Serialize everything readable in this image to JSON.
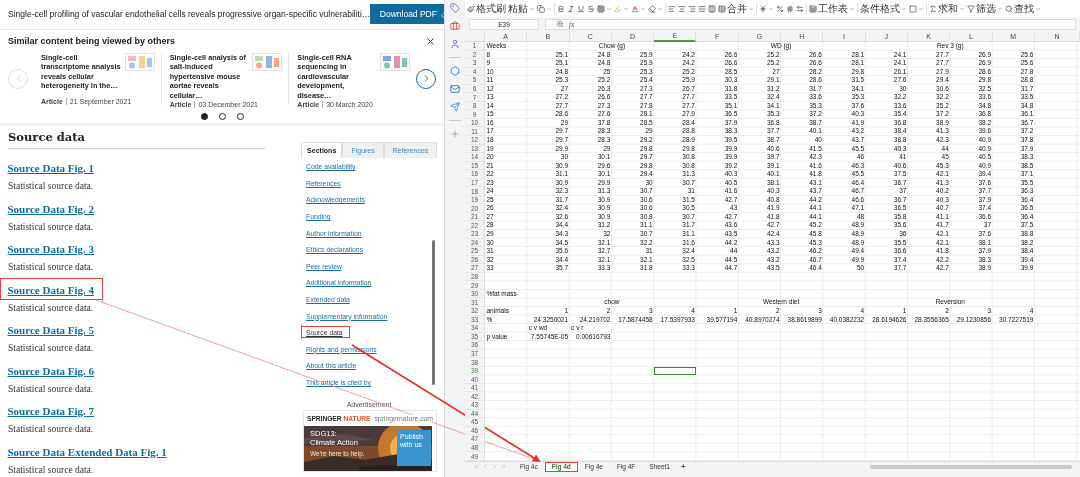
{
  "article": {
    "title": "Single-cell profiling of vascular endothelial cells reveals progressive organ-specific vulnerabiliti…",
    "download_button": "Download PDF"
  },
  "similar": {
    "heading": "Similar content being viewed by others",
    "cards": [
      {
        "title": "Single-cell transcriptome analysis reveals cellular heterogeneity in the…",
        "type": "Article",
        "date": "21 September 2021"
      },
      {
        "title": "Single-cell analysis of salt-induced hypertensive mouse aortae reveals cellular…",
        "type": "Article",
        "date": "03 December 2021"
      },
      {
        "title": "Single-cell RNA sequencing in cardiovascular development, disease…",
        "type": "Article",
        "date": "30 March 2020"
      }
    ],
    "dots": [
      {
        "selected": true
      },
      {
        "selected": false
      },
      {
        "selected": false
      }
    ]
  },
  "source_data": {
    "heading": "Source data",
    "items": [
      {
        "title": "Source Data Fig. 1",
        "description": "Statistical source data.",
        "highlighted": false
      },
      {
        "title": "Source Data Fig. 2",
        "description": "Statistical source data.",
        "highlighted": false
      },
      {
        "title": "Source Data Fig. 3",
        "description": "Statistical source data.",
        "highlighted": false
      },
      {
        "title": "Source Data Fig. 4",
        "description": "Statistical source data.",
        "highlighted": true
      },
      {
        "title": "Source Data Fig. 5",
        "description": "Statistical source data.",
        "highlighted": false
      },
      {
        "title": "Source Data Fig. 6",
        "description": "Statistical source data.",
        "highlighted": false
      },
      {
        "title": "Source Data Fig. 7",
        "description": "Statistical source data.",
        "highlighted": false
      },
      {
        "title": "Source Data Extended Data Fig. 1",
        "description": "Statistical source data.",
        "highlighted": false
      }
    ]
  },
  "sidebar": {
    "tabs": [
      {
        "label": "Sections",
        "selected": true
      },
      {
        "label": "Figures",
        "selected": false
      },
      {
        "label": "References",
        "selected": false
      }
    ],
    "items": [
      {
        "label": "Code availability",
        "selected": false,
        "highlighted": false
      },
      {
        "label": "References",
        "selected": false,
        "highlighted": false
      },
      {
        "label": "Acknowledgements",
        "selected": false,
        "highlighted": false
      },
      {
        "label": "Funding",
        "selected": false,
        "highlighted": false
      },
      {
        "label": "Author information",
        "selected": false,
        "highlighted": false
      },
      {
        "label": "Ethics declarations",
        "selected": false,
        "highlighted": false
      },
      {
        "label": "Peer review",
        "selected": false,
        "highlighted": false
      },
      {
        "label": "Additional information",
        "selected": false,
        "highlighted": false
      },
      {
        "label": "Extended data",
        "selected": false,
        "highlighted": false
      },
      {
        "label": "Supplementary information",
        "selected": false,
        "highlighted": false
      },
      {
        "label": "Source data",
        "selected": true,
        "highlighted": true
      },
      {
        "label": "Rights and permissions",
        "selected": false,
        "highlighted": false
      },
      {
        "label": "About this article",
        "selected": false,
        "highlighted": false
      },
      {
        "label": "This article is cited by",
        "selected": false,
        "highlighted": false
      }
    ]
  },
  "advertisement": {
    "label": "Advertisement",
    "brand_words": [
      "SPRINGER",
      "NATURE"
    ],
    "site": "springernature.com",
    "headline": [
      "SDG13:",
      "Climate Action"
    ],
    "tagline": "We're here to help.",
    "badge": "Publish with us"
  },
  "spreadsheet": {
    "toolbar_labels": [
      "格式刷",
      "粘贴",
      "合并",
      "工作表",
      "条件格式",
      "求和",
      "筛选",
      "查找"
    ],
    "name_box": "E39",
    "function_label": "fx",
    "columns": [
      {
        "label": "A",
        "selected": false
      },
      {
        "label": "B",
        "selected": false
      },
      {
        "label": "C",
        "selected": false
      },
      {
        "label": "D",
        "selected": false
      },
      {
        "label": "E",
        "selected": true
      },
      {
        "label": "F",
        "selected": false
      },
      {
        "label": "G",
        "selected": false
      },
      {
        "label": "H",
        "selected": false
      },
      {
        "label": "I",
        "selected": false
      },
      {
        "label": "J",
        "selected": false
      },
      {
        "label": "K",
        "selected": false
      },
      {
        "label": "L",
        "selected": false
      },
      {
        "label": "M",
        "selected": false
      },
      {
        "label": "N",
        "selected": false
      }
    ],
    "rows": [
      {
        "num": "1",
        "selected": false,
        "kind": "header",
        "cells": [
          "Weeks",
          "Chow (g)",
          "WD (g)",
          "Rev 3 (g)"
        ]
      },
      {
        "num": "2",
        "selected": false,
        "kind": "data",
        "cells": [
          "8",
          "25.1",
          "24.8",
          "25.9",
          "24.2",
          "26.6",
          "25.2",
          "26.6",
          "28.1",
          "24.1",
          "27.7",
          "26.9",
          "25.6"
        ]
      },
      {
        "num": "3",
        "selected": false,
        "kind": "data",
        "cells": [
          "9",
          "25.1",
          "24.8",
          "25.9",
          "24.2",
          "26.6",
          "25.2",
          "26.6",
          "28.1",
          "24.1",
          "27.7",
          "26.9",
          "25.6"
        ]
      },
      {
        "num": "4",
        "selected": false,
        "kind": "data",
        "cells": [
          "10",
          "24.8",
          "25",
          "25.3",
          "25.2",
          "28.5",
          "27",
          "28.2",
          "29.8",
          "26.1",
          "27.9",
          "28.6",
          "27.8"
        ]
      },
      {
        "num": "5",
        "selected": false,
        "kind": "data",
        "cells": [
          "11",
          "25.3",
          "25.2",
          "25.4",
          "25.9",
          "30.3",
          "29.1",
          "28.6",
          "31.5",
          "27.6",
          "29.4",
          "29.8",
          "28.8"
        ]
      },
      {
        "num": "6",
        "selected": false,
        "kind": "data",
        "cells": [
          "12",
          "27",
          "26.3",
          "27.3",
          "26.7",
          "31.8",
          "31.2",
          "31.7",
          "34.1",
          "30",
          "30.6",
          "32.5",
          "31.7"
        ]
      },
      {
        "num": "7",
        "selected": false,
        "kind": "data",
        "cells": [
          "13",
          "27.2",
          "26.6",
          "27.7",
          "27.7",
          "33.5",
          "32.4",
          "33.6",
          "35.3",
          "32.2",
          "32.2",
          "33.6",
          "33.5"
        ]
      },
      {
        "num": "8",
        "selected": false,
        "kind": "data",
        "cells": [
          "14",
          "27.7",
          "27.3",
          "27.8",
          "27.7",
          "35.1",
          "34.1",
          "35.3",
          "37.6",
          "33.6",
          "35.2",
          "34.8",
          "34.8"
        ]
      },
      {
        "num": "9",
        "selected": false,
        "kind": "data",
        "cells": [
          "15",
          "28.6",
          "27.6",
          "28.1",
          "27.9",
          "36.5",
          "35.3",
          "37.2",
          "40.3",
          "35.4",
          "37.2",
          "36.8",
          "36.1"
        ]
      },
      {
        "num": "10",
        "selected": false,
        "kind": "data",
        "cells": [
          "16",
          "29",
          "37.8",
          "28.5",
          "28.4",
          "37.9",
          "36.8",
          "38.7",
          "41.9",
          "36.8",
          "38.9",
          "38.2",
          "36.7"
        ]
      },
      {
        "num": "11",
        "selected": false,
        "kind": "data",
        "cells": [
          "17",
          "29.7",
          "28.3",
          "29",
          "28.8",
          "38.3",
          "37.7",
          "40.1",
          "43.2",
          "38.4",
          "41.3",
          "39.6",
          "37.2"
        ]
      },
      {
        "num": "12",
        "selected": false,
        "kind": "data",
        "cells": [
          "18",
          "29.7",
          "28.3",
          "29.2",
          "28.9",
          "39.5",
          "38.7",
          "40",
          "43.7",
          "38.8",
          "42.3",
          "40.9",
          "37.8"
        ]
      },
      {
        "num": "13",
        "selected": false,
        "kind": "data",
        "cells": [
          "19",
          "29.9",
          "29",
          "29.8",
          "29.8",
          "39.9",
          "40.6",
          "41.5",
          "45.5",
          "40.3",
          "44",
          "40.9",
          "37.9"
        ]
      },
      {
        "num": "14",
        "selected": false,
        "kind": "data",
        "cells": [
          "20",
          "30",
          "30.1",
          "29.7",
          "30.8",
          "39.9",
          "39.7",
          "42.3",
          "46",
          "41",
          "45",
          "40.5",
          "38.3"
        ]
      },
      {
        "num": "15",
        "selected": false,
        "kind": "data",
        "cells": [
          "21",
          "30.9",
          "29.6",
          "29.8",
          "30.8",
          "39.2",
          "39.1",
          "41.6",
          "46.3",
          "40.6",
          "45.3",
          "40.9",
          "38.5"
        ]
      },
      {
        "num": "16",
        "selected": false,
        "kind": "data",
        "cells": [
          "22",
          "31.1",
          "30.1",
          "29.4",
          "31.3",
          "40.3",
          "40.1",
          "41.8",
          "45.5",
          "37.5",
          "42.1",
          "39.4",
          "37.1"
        ]
      },
      {
        "num": "17",
        "selected": false,
        "kind": "data",
        "cells": [
          "23",
          "30.9",
          "29.9",
          "30",
          "30.7",
          "40.5",
          "38.1",
          "43.1",
          "46.4",
          "36.7",
          "41.3",
          "37.6",
          "35.5"
        ]
      },
      {
        "num": "18",
        "selected": false,
        "kind": "data",
        "cells": [
          "24",
          "32.3",
          "31.3",
          "30.7",
          "31",
          "41.6",
          "40.3",
          "43.7",
          "46.7",
          "37",
          "40.2",
          "37.7",
          "36.3"
        ]
      },
      {
        "num": "19",
        "selected": false,
        "kind": "data",
        "cells": [
          "25",
          "31.7",
          "30.9",
          "30.6",
          "31.5",
          "42.7",
          "40.8",
          "44.2",
          "46.6",
          "36.7",
          "40.3",
          "37.9",
          "36.4"
        ]
      },
      {
        "num": "20",
        "selected": false,
        "kind": "data",
        "cells": [
          "26",
          "32.4",
          "30.9",
          "30.6",
          "30.5",
          "43",
          "41.9",
          "44.1",
          "47.1",
          "36.5",
          "40.7",
          "37.4",
          "36.5"
        ]
      },
      {
        "num": "21",
        "selected": false,
        "kind": "data",
        "cells": [
          "27",
          "32.6",
          "30.9",
          "30.8",
          "30.7",
          "42.7",
          "41.8",
          "44.1",
          "48",
          "35.8",
          "41.1",
          "36.6",
          "36.4"
        ]
      },
      {
        "num": "22",
        "selected": false,
        "kind": "data",
        "cells": [
          "28",
          "34.4",
          "31.2",
          "31.1",
          "31.7",
          "43.6",
          "42.7",
          "45.2",
          "48.9",
          "35.6",
          "41.7",
          "37",
          "37.5"
        ]
      },
      {
        "num": "23",
        "selected": false,
        "kind": "data",
        "cells": [
          "29",
          "34.3",
          "32",
          "30.7",
          "31.1",
          "43.5",
          "42.4",
          "45.8",
          "48.9",
          "36",
          "42.1",
          "37.6",
          "38.8"
        ]
      },
      {
        "num": "24",
        "selected": false,
        "kind": "data",
        "cells": [
          "30",
          "34.5",
          "32.1",
          "32.2",
          "31.6",
          "44.2",
          "43.3",
          "45.3",
          "48.9",
          "35.5",
          "42.1",
          "38.1",
          "38.2"
        ]
      },
      {
        "num": "25",
        "selected": false,
        "kind": "data",
        "cells": [
          "31",
          "35.6",
          "32.7",
          "31",
          "32.4",
          "44",
          "43.2",
          "46.2",
          "49.4",
          "36.6",
          "41.8",
          "37.9",
          "38.4"
        ]
      },
      {
        "num": "26",
        "selected": false,
        "kind": "data",
        "cells": [
          "32",
          "34.4",
          "32.1",
          "32.1",
          "32.5",
          "44.5",
          "43.2",
          "46.7",
          "49.9",
          "37.4",
          "42.2",
          "38.3",
          "39.4"
        ]
      },
      {
        "num": "27",
        "selected": false,
        "kind": "data",
        "cells": [
          "33",
          "35.7",
          "33.3",
          "31.8",
          "33.3",
          "44.7",
          "43.5",
          "46.4",
          "50",
          "37.7",
          "42.7",
          "38.9",
          "39.9"
        ]
      },
      {
        "num": "28",
        "selected": false,
        "kind": "empty"
      },
      {
        "num": "29",
        "selected": false,
        "kind": "empty"
      },
      {
        "num": "30",
        "selected": false,
        "kind": "data",
        "cells": [
          "%fat mass"
        ]
      },
      {
        "num": "31",
        "selected": false,
        "kind": "header",
        "cells": [
          "",
          "chow",
          "Western diet",
          "Reversion"
        ]
      },
      {
        "num": "32",
        "selected": false,
        "kind": "data",
        "cells": [
          "animals",
          "1",
          "2",
          "3",
          "4",
          "1",
          "2",
          "3",
          "4",
          "1",
          "2",
          "3",
          "4"
        ]
      },
      {
        "num": "33",
        "selected": false,
        "kind": "data",
        "cells": [
          "%",
          "24.3250021",
          "24.219702",
          "17.5874458",
          "17.5397933",
          "39.577194",
          "40.8970274",
          "38.8619899",
          "40.0382232",
          "28.6194626",
          "28.3556365",
          "29.1230856",
          "30.7227519"
        ]
      },
      {
        "num": "34",
        "selected": false,
        "kind": "comparison",
        "cells": [
          "c v wd",
          "c v r"
        ]
      },
      {
        "num": "35",
        "selected": false,
        "kind": "data",
        "cells": [
          "p value",
          "7.55745E-05",
          "0.00616793"
        ]
      },
      {
        "num": "36",
        "selected": false,
        "kind": "empty"
      },
      {
        "num": "37",
        "selected": false,
        "kind": "empty"
      },
      {
        "num": "38",
        "selected": false,
        "kind": "empty"
      },
      {
        "num": "39",
        "selected": true,
        "kind": "empty"
      },
      {
        "num": "40",
        "selected": false,
        "kind": "empty"
      },
      {
        "num": "41",
        "selected": false,
        "kind": "empty"
      },
      {
        "num": "42",
        "selected": false,
        "kind": "empty"
      },
      {
        "num": "43",
        "selected": false,
        "kind": "empty"
      },
      {
        "num": "44",
        "selected": false,
        "kind": "empty"
      },
      {
        "num": "45",
        "selected": false,
        "kind": "empty"
      },
      {
        "num": "46",
        "selected": false,
        "kind": "empty"
      },
      {
        "num": "47",
        "selected": false,
        "kind": "empty"
      },
      {
        "num": "48",
        "selected": false,
        "kind": "empty"
      },
      {
        "num": "49",
        "selected": false,
        "kind": "empty"
      }
    ],
    "sheet_tabs": [
      {
        "label": "Fig 4c",
        "selected": false,
        "highlighted": false
      },
      {
        "label": "Fig 4d",
        "selected": true,
        "highlighted": true
      },
      {
        "label": "Fig 4e",
        "selected": false,
        "highlighted": false
      },
      {
        "label": "Fig 4F",
        "selected": false,
        "highlighted": false
      },
      {
        "label": "Sheet1",
        "selected": false,
        "highlighted": false
      }
    ],
    "add_sheet": "+"
  }
}
